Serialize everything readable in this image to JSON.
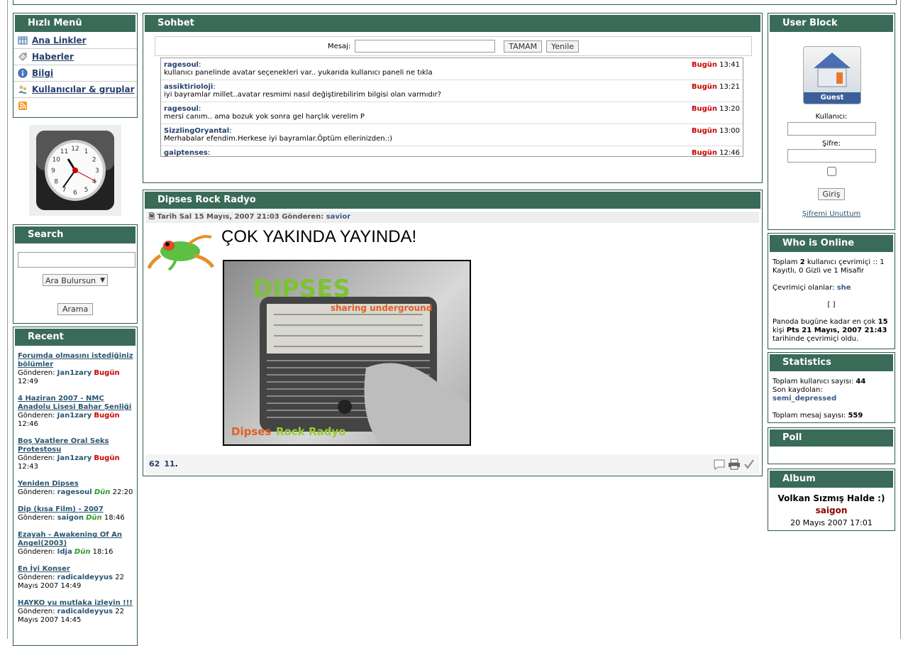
{
  "quick_menu": {
    "title": "Hızlı Menü",
    "items": [
      {
        "label": "Ana Linkler",
        "icon": "table-icon"
      },
      {
        "label": "Haberler",
        "icon": "tag-icon"
      },
      {
        "label": "Bilgi",
        "icon": "info-icon"
      },
      {
        "label": "Kullanıcılar & gruplar",
        "icon": "users-icon"
      },
      {
        "label": "",
        "icon": "rss-icon"
      }
    ]
  },
  "clock": {
    "numbers": [
      "12",
      "1",
      "2",
      "3",
      "4",
      "5",
      "6",
      "7",
      "8",
      "9",
      "10",
      "11"
    ]
  },
  "search": {
    "title": "Search",
    "select_value": "Ara Bulursun",
    "button": "Arama"
  },
  "recent": {
    "title": "Recent",
    "by_prefix": "Gönderen:",
    "items": [
      {
        "title": "Forumda olmasını istediğiniz bölümler",
        "user": "Jan1zary",
        "day": "Bugün",
        "day_type": "today",
        "time": "12:49"
      },
      {
        "title": "4 Haziran 2007 - NMÇ Anadolu Lisesi Bahar Şenliği",
        "user": "Jan1zary",
        "day": "Bugün",
        "day_type": "today",
        "time": "12:46"
      },
      {
        "title": "Boş Vaatlere Oral Seks Protestosu",
        "user": "Jan1zary",
        "day": "Bugün",
        "day_type": "today",
        "time": "12:43"
      },
      {
        "title": "Yeniden Dipses",
        "user": "ragesoul",
        "day": "Dün",
        "day_type": "yesterday",
        "time": "22:20"
      },
      {
        "title": "Dip (kısa Film) - 2007",
        "user": "saigon",
        "day": "Dün",
        "day_type": "yesterday",
        "time": "18:46"
      },
      {
        "title": "Ezayah - Awakening Of An Angel(2003)",
        "user": "Idja",
        "day": "Dün",
        "day_type": "yesterday",
        "time": "18:16"
      },
      {
        "title": "En İyi Konser",
        "user": "radicaldeyyus",
        "day": "22 Mayıs 2007",
        "day_type": "date",
        "time": "14:49"
      },
      {
        "title": "HAYKO yu mutlaka izleyin !!!",
        "user": "radicaldeyyus",
        "day": "22 Mayıs 2007",
        "day_type": "date",
        "time": "14:45"
      }
    ]
  },
  "chat": {
    "title": "Sohbet",
    "message_label": "Mesaj:",
    "ok_button": "TAMAM",
    "refresh_button": "Yenile",
    "messages": [
      {
        "user": "ragesoul",
        "text": "kullanıcı panelinde avatar seçenekleri var.. yukarıda kullanıcı paneli ne tıkla",
        "day": "Bugün",
        "time": "13:41"
      },
      {
        "user": "assiktirioloji",
        "text": "iyi bayramlar millet..avatar resmimi nasıl değiştirebilirim bilgisi olan varmıdır?",
        "day": "Bugün",
        "time": "13:21"
      },
      {
        "user": "ragesoul",
        "text": "mersi canım.. ama bozuk yok sonra gel harçlık verelim P",
        "day": "Bugün",
        "time": "13:20"
      },
      {
        "user": "SizzlingOryantal",
        "text": "Merhabalar efendim.Herkese iyi bayramlar.Öptüm ellerinizden.:)",
        "day": "Bugün",
        "time": "13:00"
      },
      {
        "user": "gaiptenses",
        "text": "",
        "day": "Bugün",
        "time": "12:46"
      }
    ]
  },
  "radio": {
    "title": "Dipses Rock Radyo",
    "meta_prefix": "Tarih Sal 15 Mayıs, 2007 21:03 Gönderen:",
    "author": "savior",
    "headline": "ÇOK YAKINDA YAYINDA!",
    "image_text": {
      "logo": "DIPSES",
      "tagline": "sharing underground",
      "brand1": "Dipses",
      "brand2": "Rock Radyo"
    },
    "footer_links": [
      "62",
      "11"
    ],
    "footer_suffix": "."
  },
  "user_block": {
    "title": "User Block",
    "avatar_label": "Guest",
    "user_label": "Kullanıcı:",
    "password_label": "Şifre:",
    "login_button": "Giriş",
    "forgot_link": "Şifremi Unuttum"
  },
  "who_online": {
    "title": "Who is Online",
    "total_pre": "Toplam",
    "total_n": "2",
    "total_post": "kullanıcı çevrimiçi :: 1 Kayıtlı, 0 Gizli ve 1 Misafir",
    "online_label": "Çevrimiçi olanlar:",
    "online_user": "she",
    "brackets": "[ ]",
    "record_pre": "Panoda bugüne kadar en çok",
    "record_n": "15",
    "record_mid": "kişi",
    "record_date": "Pts 21 Mayıs, 2007 21:43",
    "record_post": "tarihinde çevrimiçi oldu."
  },
  "statistics": {
    "title": "Statistics",
    "users_label": "Toplam kullanıcı sayısı:",
    "users": "44",
    "last_label": "Son kaydolan:",
    "last_user": "semi_depressed",
    "posts_label": "Toplam mesaj sayısı:",
    "posts": "559"
  },
  "poll": {
    "title": "Poll"
  },
  "album": {
    "title": "Album",
    "photo_title": "Volkan Sızmış Halde :)",
    "user": "saigon",
    "date": "20 Mayıs 2007 17:01"
  },
  "colors": {
    "header": "#3a6a58",
    "today": "#cc0000",
    "yesterday": "#2a9a2a",
    "link": "#25406d"
  }
}
